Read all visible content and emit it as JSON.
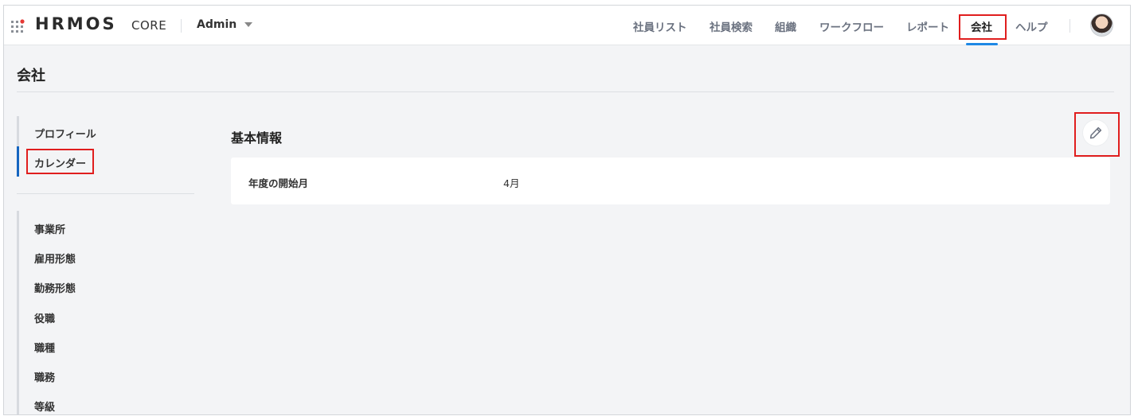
{
  "app": {
    "logo": "HRMOS",
    "product": "CORE",
    "role_select": "Admin"
  },
  "nav": [
    {
      "label": "社員リスト"
    },
    {
      "label": "社員検索"
    },
    {
      "label": "組織"
    },
    {
      "label": "ワークフロー"
    },
    {
      "label": "レポート"
    },
    {
      "label": "会社",
      "active": true
    },
    {
      "label": "ヘルプ"
    }
  ],
  "page": {
    "title": "会社"
  },
  "sidebar": {
    "group1": [
      {
        "label": "プロフィール"
      },
      {
        "label": "カレンダー",
        "active": true
      }
    ],
    "group2": [
      {
        "label": "事業所"
      },
      {
        "label": "雇用形態"
      },
      {
        "label": "勤務形態"
      },
      {
        "label": "役職"
      },
      {
        "label": "職種"
      },
      {
        "label": "職務"
      },
      {
        "label": "等級"
      }
    ]
  },
  "main": {
    "section_title": "基本情報",
    "fields": [
      {
        "label": "年度の開始月",
        "value": "4月"
      }
    ]
  },
  "colors": {
    "accent": "#1e88e5",
    "highlight": "#e01e1e",
    "logo_dot": "#e53935"
  },
  "icons": [
    "apps-grid-icon",
    "chevron-down-icon",
    "avatar",
    "pencil-icon"
  ]
}
